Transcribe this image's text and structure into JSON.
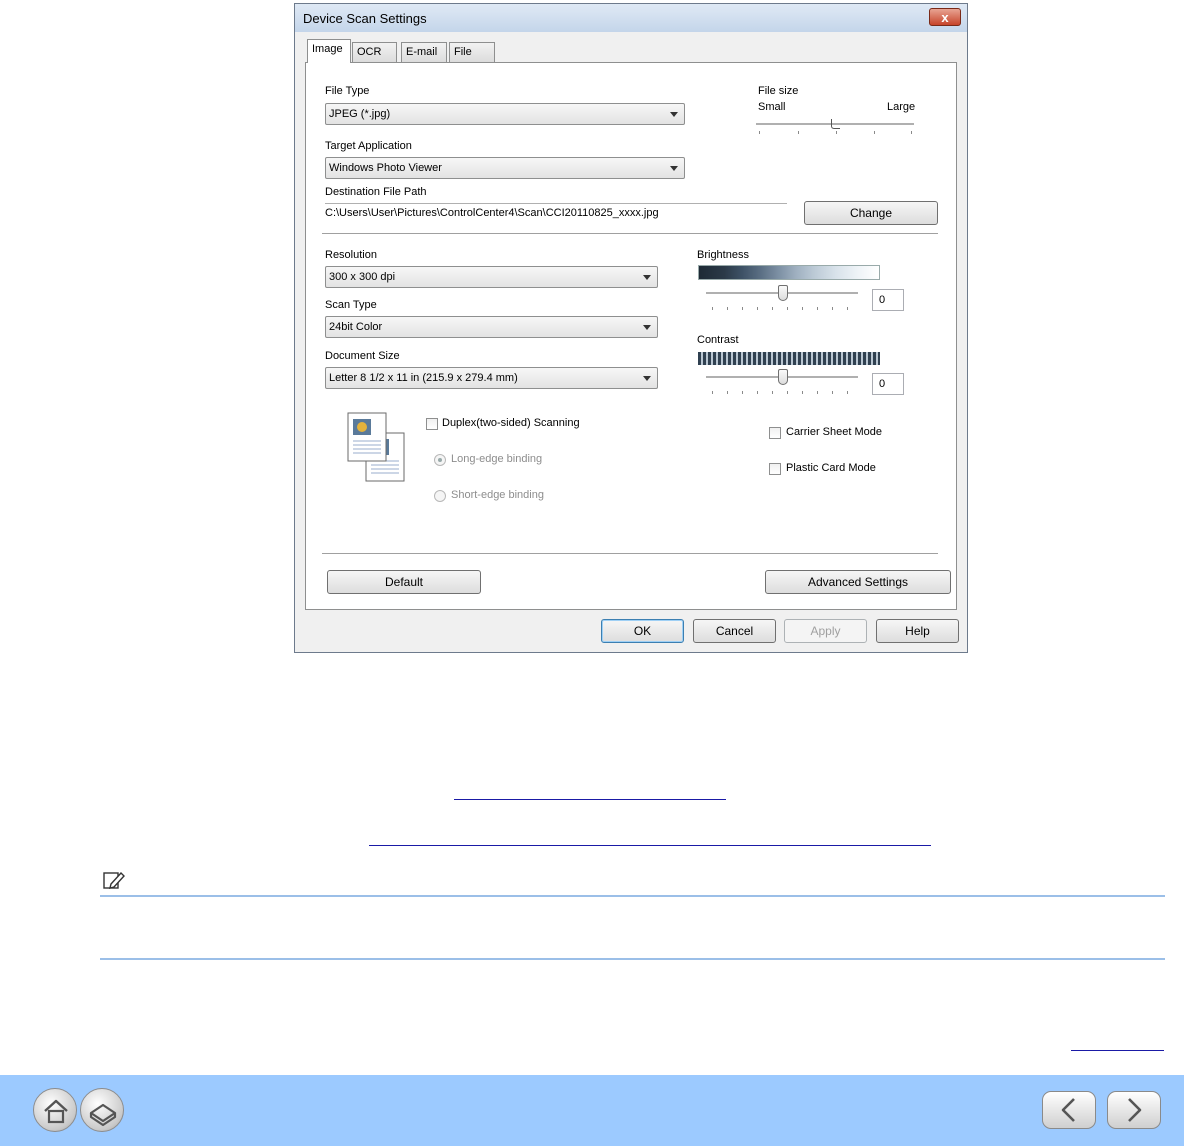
{
  "dialog": {
    "title": "Device Scan Settings",
    "close_glyph": "x",
    "tabs": [
      {
        "label": "Image",
        "active": true
      },
      {
        "label": "OCR",
        "active": false
      },
      {
        "label": "E-mail",
        "active": false
      },
      {
        "label": "File",
        "active": false
      }
    ],
    "file_type": {
      "label": "File Type",
      "value": "JPEG (*.jpg)"
    },
    "file_size": {
      "label": "File size",
      "min_label": "Small",
      "max_label": "Large",
      "level": 0.5
    },
    "target_application": {
      "label": "Target Application",
      "value": "Windows Photo Viewer"
    },
    "destination": {
      "label": "Destination File Path",
      "value": "C:\\Users\\User\\Pictures\\ControlCenter4\\Scan\\CCI20110825_xxxx.jpg",
      "change_label": "Change"
    },
    "resolution": {
      "label": "Resolution",
      "value": "300 x 300 dpi"
    },
    "scan_type": {
      "label": "Scan Type",
      "value": "24bit Color"
    },
    "document_size": {
      "label": "Document Size",
      "value": "Letter 8 1/2 x 11 in (215.9 x 279.4 mm)"
    },
    "brightness": {
      "label": "Brightness",
      "value": "0",
      "level": 0.5
    },
    "contrast": {
      "label": "Contrast",
      "value": "0",
      "level": 0.5
    },
    "duplex": {
      "label": "Duplex(two-sided) Scanning",
      "checked": false
    },
    "long_edge": {
      "label": "Long-edge binding",
      "selected": true
    },
    "short_edge": {
      "label": "Short-edge binding",
      "selected": false
    },
    "carrier_sheet": {
      "label": "Carrier Sheet Mode",
      "checked": false
    },
    "plastic_card": {
      "label": "Plastic Card Mode",
      "checked": false
    },
    "default_label": "Default",
    "advanced_label": "Advanced Settings",
    "ok_label": "OK",
    "cancel_label": "Cancel",
    "apply_label": "Apply",
    "help_label": "Help"
  },
  "colors": {
    "footer_bar": "#9ccaff",
    "note_rule": "#9bbfe8",
    "link": "#1a1aa6"
  },
  "footer": {
    "home_icon": "home-icon",
    "printer_icon": "printer-icon",
    "prev_icon": "chevron-left-icon",
    "next_icon": "chevron-right-icon"
  }
}
